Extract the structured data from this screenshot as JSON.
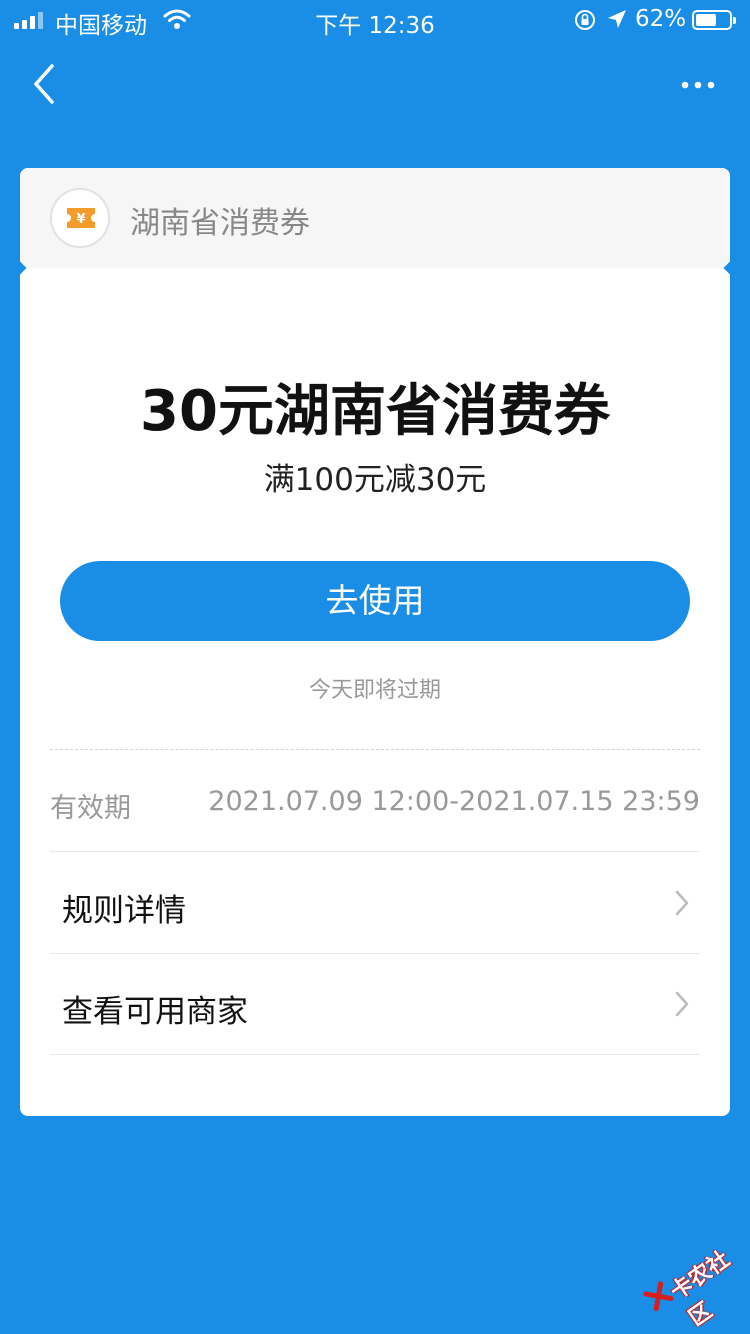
{
  "status_bar": {
    "carrier": "中国移动",
    "time": "下午 12:36",
    "battery_percent": "62%",
    "battery_level": 0.62
  },
  "nav": {
    "back_icon": "chevron-left-icon",
    "more_icon": "more-dots-icon"
  },
  "card": {
    "header_title": "湖南省消费券",
    "logo_icon": "ticket-yen-icon",
    "coupon_name": "30元湖南省消费券",
    "coupon_rule": "满100元减30元",
    "use_button_label": "去使用",
    "expiry_note": "今天即将过期",
    "validity_label": "有效期",
    "validity_value": "2021.07.09 12:00-2021.07.15 23:59",
    "links": [
      {
        "label": "规则详情"
      },
      {
        "label": "查看可用商家"
      }
    ]
  },
  "watermark": {
    "text": "卡农社区"
  },
  "colors": {
    "primary_blue": "#1a8ee6",
    "ticket_orange": "#f39c2b"
  }
}
